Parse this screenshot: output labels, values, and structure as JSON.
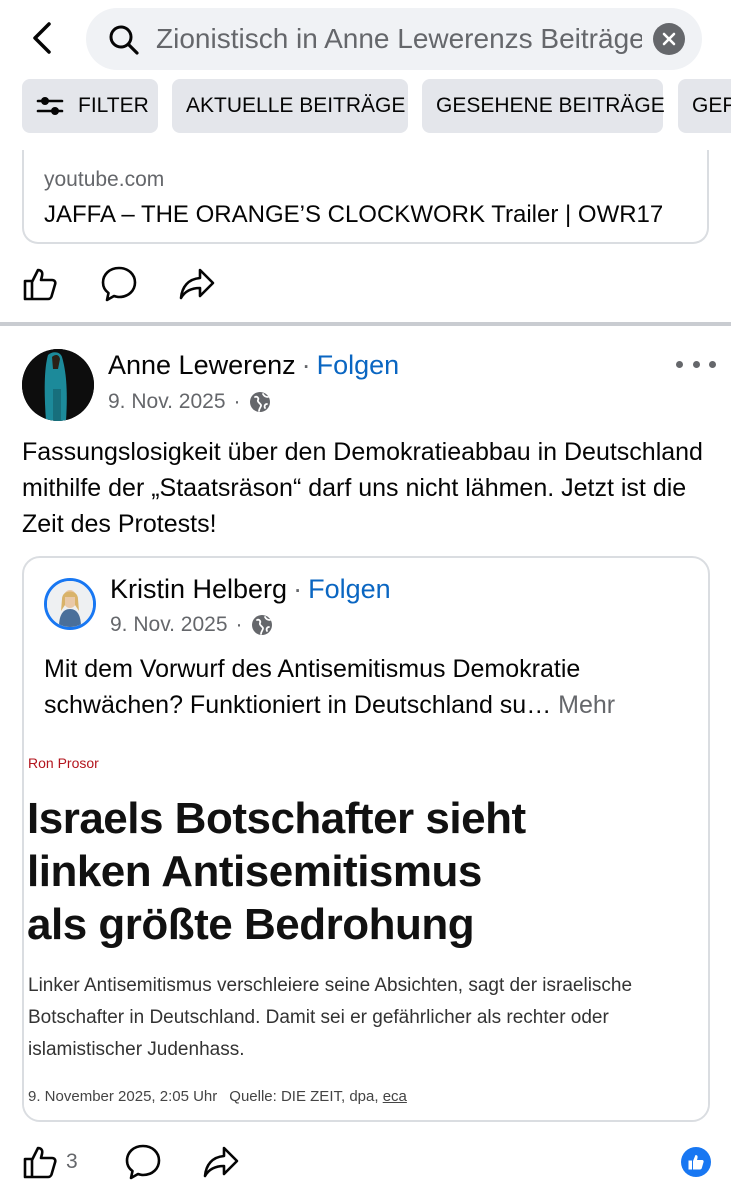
{
  "search": {
    "value": "Zionistisch in Anne Lewerenzs Beiträgen"
  },
  "filters": [
    {
      "label": "FILTER",
      "icon": "sliders-icon"
    },
    {
      "label": "AKTUELLE BEITRÄGE"
    },
    {
      "label": "GESEHENE BEITRÄGE"
    },
    {
      "label": "GEP"
    }
  ],
  "previous_post": {
    "link": {
      "domain": "youtube.com",
      "title": "JAFFA – THE ORANGE’S CLOCKWORK Trailer | OWR17"
    }
  },
  "post": {
    "author": "Anne Lewerenz",
    "separator": "·",
    "follow": "Folgen",
    "date": "9. Nov. 2025",
    "date_sep": "·",
    "text": "Fassungslosigkeit über den Demokratieabbau in Deutschland mithilfe der „Staatsräson“ darf uns nicht lähmen. Jetzt ist die Zeit des Protests!",
    "likes": "3",
    "shared": {
      "author": "Kristin Helberg",
      "follow": "Folgen",
      "date": "9. Nov. 2025",
      "text": "Mit dem Vorwurf des Antisemitismus Demokratie schwächen? Funktioniert in Deutschland su…",
      "more": "Mehr",
      "article": {
        "kicker": "Ron Prosor",
        "headline_1": "Israels Botschafter sieht",
        "headline_2": "linken Antisemitismus",
        "headline_3": "als größte Bedrohung",
        "lead": "Linker Antisemitismus verschleiere seine Absichten, sagt der israelische Botschafter in Deutschland. Damit sei er gefährlicher als rechter oder islamistischer Judenhass.",
        "timestamp": "9. November 2025, 2:05 Uhr",
        "source_prefix": "Quelle: DIE ZEIT, dpa,",
        "source_link": "eca"
      }
    }
  },
  "colors": {
    "link_blue": "#0a66c2",
    "fb_blue": "#1877f2",
    "kicker_red": "#b3141d",
    "muted": "#65676b"
  }
}
